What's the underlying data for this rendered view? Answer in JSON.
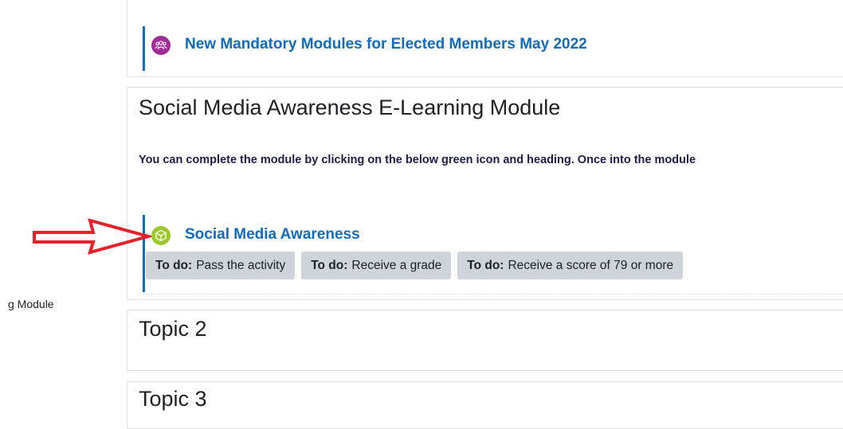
{
  "sidebar": {
    "partial_item": "g Module"
  },
  "sections": {
    "previous": {
      "activity_title": "New Mandatory Modules for Elected Members May 2022",
      "activity_icon": "group-forum-icon",
      "activity_icon_color": "#a12b97"
    },
    "social_media": {
      "title": "Social Media Awareness E-Learning Module",
      "summary": "You can complete the module by clicking on the below green icon and heading. Once into the module",
      "activity": {
        "title": "Social Media Awareness",
        "icon": "scorm-package-icon",
        "icon_color": "#9bc92a",
        "completion": [
          {
            "label": "To do:",
            "text": "Pass the activity"
          },
          {
            "label": "To do:",
            "text": "Receive a grade"
          },
          {
            "label": "To do:",
            "text": "Receive a score of 79 or more"
          }
        ]
      }
    },
    "topic2": {
      "title": "Topic 2"
    },
    "topic3": {
      "title": "Topic 3"
    }
  },
  "annotation": {
    "arrow_color": "#e8202a",
    "arrow_icon": "red-outline-arrow-icon"
  },
  "colors": {
    "link": "#0f6cbf",
    "summary_text": "#1e1b4e",
    "badge_bg": "#ced4da"
  }
}
